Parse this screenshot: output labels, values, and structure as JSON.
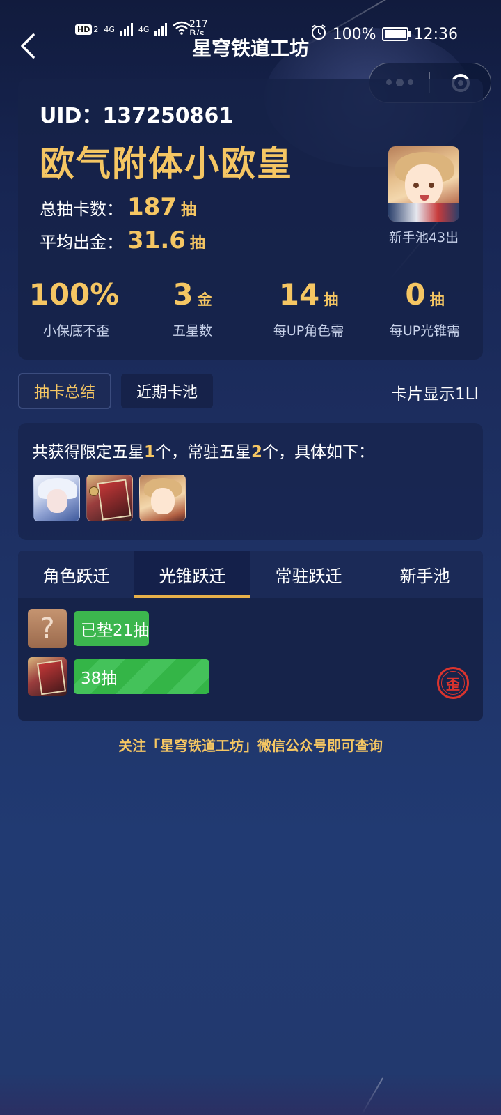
{
  "status_bar": {
    "hd_label": "HD",
    "hd_sub": "2",
    "net1": "4G",
    "net2": "4G",
    "speed_value": "217",
    "speed_unit": "B/s",
    "battery_percent": "100%",
    "time": "12:36"
  },
  "header": {
    "title": "星穹铁道工坊"
  },
  "summary": {
    "uid": "UID：137250861",
    "rank_title": "欧气附体小欧皇",
    "total_label": "总抽卡数：",
    "total_value": "187",
    "total_unit": "抽",
    "avg_label": "平均出金：",
    "avg_value": "31.6",
    "avg_unit": "抽",
    "avatar_caption": "新手池43出",
    "stats": [
      {
        "value": "100%",
        "unit": "",
        "label": "小保底不歪"
      },
      {
        "value": "3",
        "unit": "金",
        "label": "五星数"
      },
      {
        "value": "14",
        "unit": "抽",
        "label": "每UP角色需"
      },
      {
        "value": "0",
        "unit": "抽",
        "label": "每UP光锥需"
      }
    ]
  },
  "view_tabs": {
    "tab1": "抽卡总结",
    "tab2": "近期卡池",
    "display_option": "卡片显示1LI"
  },
  "obtained": {
    "prefix": "共获得限定五星",
    "limited_count": "1",
    "middle": "个，常驻五星",
    "standard_count": "2",
    "suffix": "个，具体如下："
  },
  "warp_tabs": [
    "角色跃迁",
    "光锥跃迁",
    "常驻跃迁",
    "新手池"
  ],
  "warp_rows": [
    {
      "label": "已垫21抽",
      "question_mark": "?",
      "progress": 0.36
    },
    {
      "label": "38抽",
      "progress": 0.65,
      "badge": "歪"
    }
  ],
  "footer": "关注「星穹铁道工坊」微信公众号即可查询",
  "colors": {
    "accent_gold": "#f5c663",
    "progress_green": "#3cb64e",
    "badge_red": "#d9342e",
    "tab_underline": "#e7b04a"
  }
}
